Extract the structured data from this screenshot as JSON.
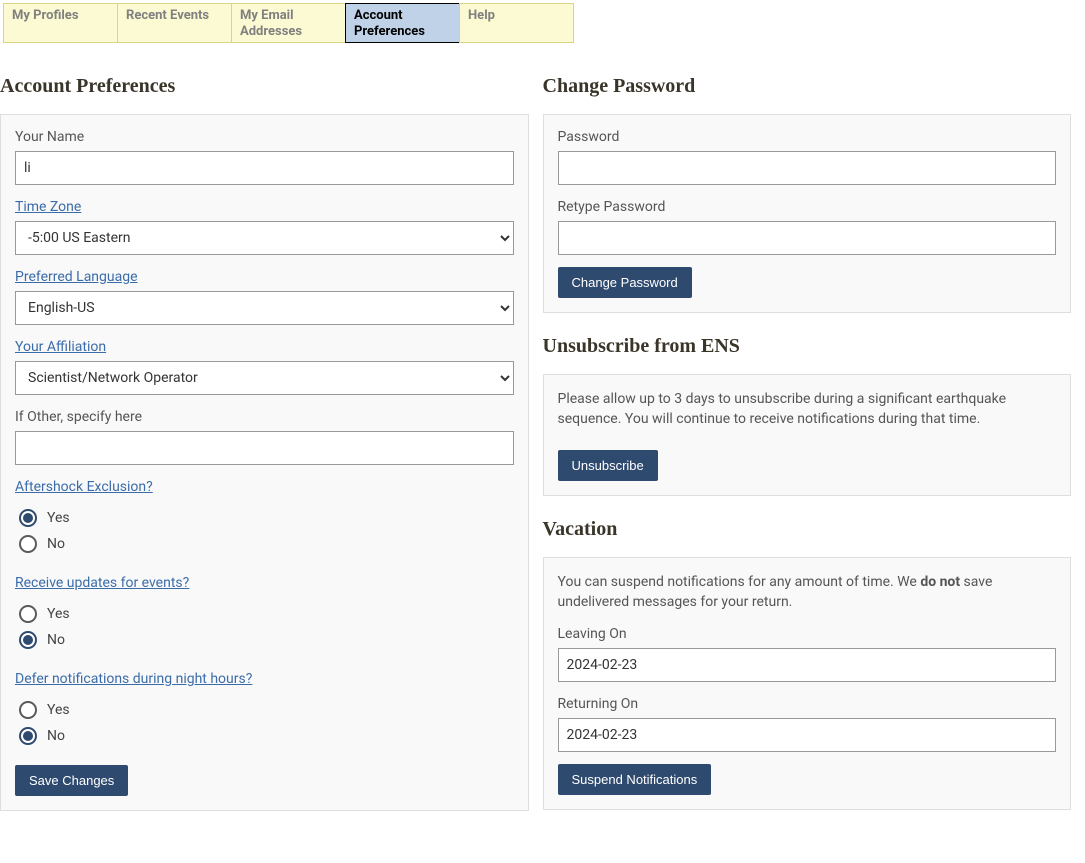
{
  "tabs": [
    {
      "label": "My Profiles",
      "active": false
    },
    {
      "label": "Recent Events",
      "active": false
    },
    {
      "label": "My Email Addresses",
      "active": false
    },
    {
      "label": "Account Preferences",
      "active": true
    },
    {
      "label": "Help",
      "active": false
    }
  ],
  "leftColumn": {
    "heading": "Account Preferences",
    "yourNameLabel": "Your Name",
    "yourNameValue": "li",
    "timeZoneLabel": "Time Zone",
    "timeZoneValue": "-5:00 US Eastern",
    "preferredLanguageLabel": "Preferred Language",
    "preferredLanguageValue": "English-US",
    "affiliationLabel": "Your Affiliation",
    "affiliationValue": "Scientist/Network Operator",
    "ifOtherLabel": "If Other, specify here",
    "ifOtherValue": "",
    "aftershockLabel": "Aftershock Exclusion?",
    "aftershockYes": "Yes",
    "aftershockNo": "No",
    "receiveUpdatesLabel": "Receive updates for events?",
    "receiveYes": "Yes",
    "receiveNo": "No",
    "deferLabel": "Defer notifications during night hours?",
    "deferYes": "Yes",
    "deferNo": "No",
    "saveBtn": "Save Changes"
  },
  "changePassword": {
    "heading": "Change Password",
    "passwordLabel": "Password",
    "retypeLabel": "Retype Password",
    "btn": "Change Password"
  },
  "unsubscribe": {
    "heading": "Unsubscribe from ENS",
    "text": "Please allow up to 3 days to unsubscribe during a significant earthquake sequence. You will continue to receive notifications during that time.",
    "btn": "Unsubscribe"
  },
  "vacation": {
    "heading": "Vacation",
    "text1": "You can suspend notifications for any amount of time. We ",
    "textBold": "do not",
    "text2": " save undelivered messages for your return.",
    "leavingLabel": "Leaving On",
    "leavingValue": "2024-02-23",
    "returningLabel": "Returning On",
    "returningValue": "2024-02-23",
    "btn": "Suspend Notifications"
  }
}
